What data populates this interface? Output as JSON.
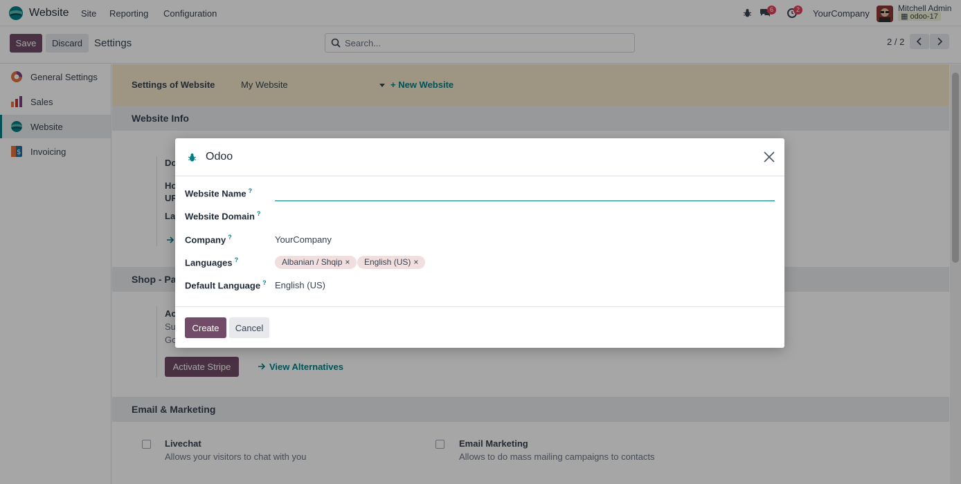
{
  "navbar": {
    "app_name": "Website",
    "menus": [
      "Site",
      "Reporting",
      "Configuration"
    ],
    "messages_count": "6",
    "activities_count": "2",
    "company": "YourCompany",
    "user_name": "Mitchell Admin",
    "database": "odoo-17"
  },
  "control_panel": {
    "save_label": "Save",
    "discard_label": "Discard",
    "title": "Settings",
    "search_placeholder": "Search...",
    "pager": "2 / 2"
  },
  "sidebar": {
    "items": [
      {
        "label": "General Settings",
        "icon": "general-settings-icon"
      },
      {
        "label": "Sales",
        "icon": "sales-icon"
      },
      {
        "label": "Website",
        "icon": "website-icon",
        "active": true
      },
      {
        "label": "Invoicing",
        "icon": "invoicing-icon"
      }
    ]
  },
  "main": {
    "settings_of_label": "Settings of Website",
    "website_select": "My Website",
    "new_website_label": "+ New Website",
    "sections": {
      "website_info": "Website Info",
      "shop": "Shop - Pay",
      "email_marketing": "Email & Marketing"
    },
    "partial_labels": {
      "domain": "Do",
      "homepage": "Ho",
      "url": "UR",
      "languages": "La",
      "account": "Ac",
      "su": "Su",
      "go": "Go"
    },
    "activate_stripe_label": "Activate Stripe",
    "view_alternatives_label": "View Alternatives",
    "livechat": {
      "title": "Livechat",
      "desc": "Allows your visitors to chat with you"
    },
    "email_marketing": {
      "title": "Email Marketing",
      "desc": "Allows to do mass mailing campaigns to contacts"
    }
  },
  "modal": {
    "title": "Odoo",
    "fields": {
      "website_name": {
        "label": "Website Name",
        "value": ""
      },
      "website_domain": {
        "label": "Website Domain",
        "value": ""
      },
      "company": {
        "label": "Company",
        "value": "YourCompany"
      },
      "languages": {
        "label": "Languages",
        "tags": [
          "Albanian / Shqip",
          "English (US)"
        ]
      },
      "default_language": {
        "label": "Default Language",
        "value": "English (US)"
      }
    },
    "help_mark": "?",
    "tag_remove": "×",
    "create_label": "Create",
    "cancel_label": "Cancel"
  },
  "colors": {
    "primary": "#714b67",
    "accent": "#017e84",
    "badge": "#e0415a"
  }
}
